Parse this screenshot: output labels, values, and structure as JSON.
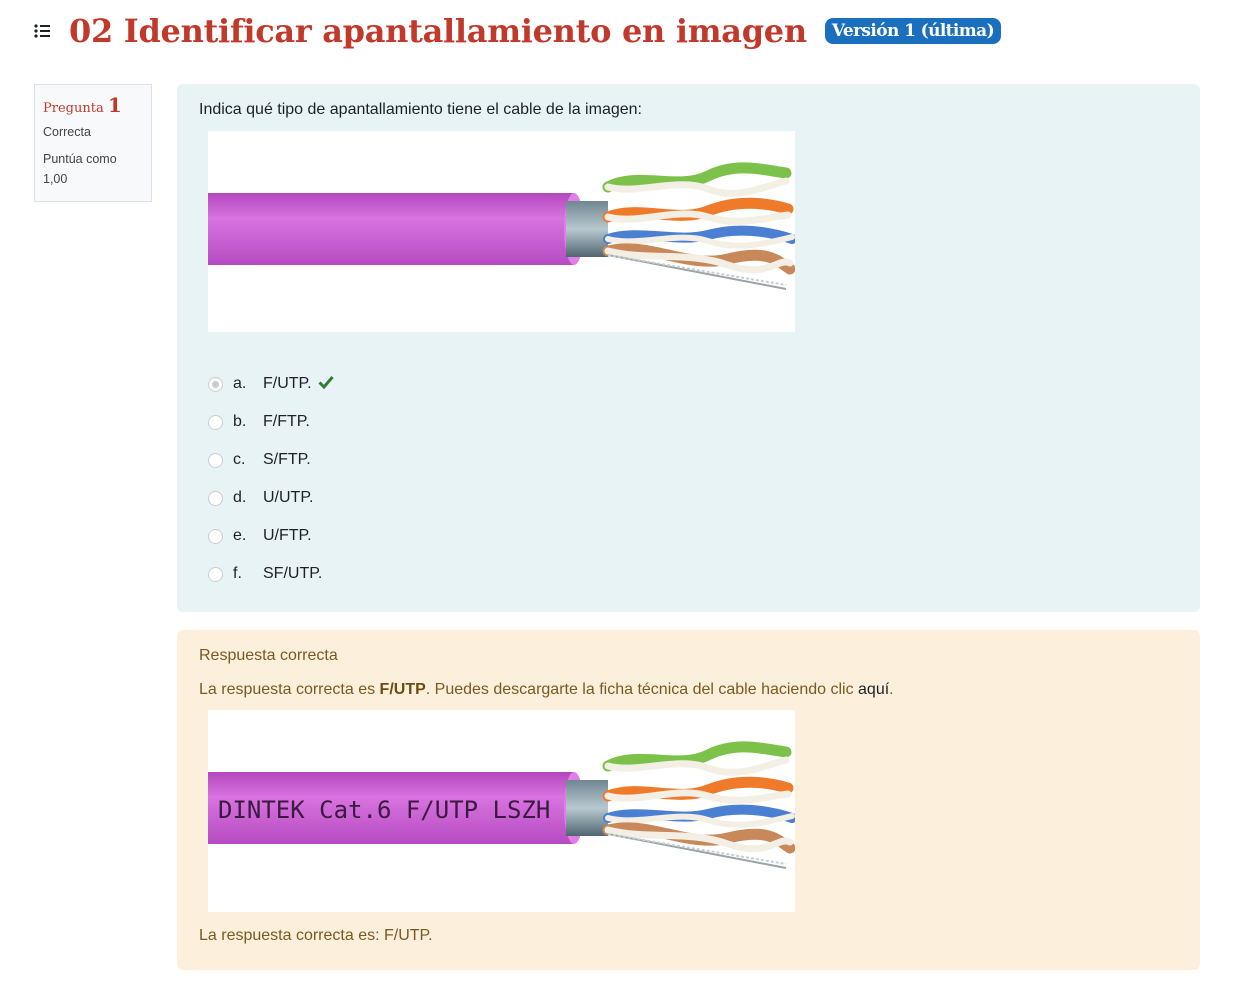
{
  "header": {
    "icon": "list-icon",
    "title": "02 Identificar apantallamiento en imagen",
    "version_badge": "Versión 1 (última)"
  },
  "info": {
    "question_label": "Pregunta",
    "question_number": "1",
    "state": "Correcta",
    "grade": "Puntúa como 1,00"
  },
  "question": {
    "text": "Indica qué tipo de apantallamiento tiene el cable de la imagen:",
    "answers": [
      {
        "letter": "a.",
        "text": "F/UTP.",
        "selected": true,
        "correct": true
      },
      {
        "letter": "b.",
        "text": "F/FTP.",
        "selected": false
      },
      {
        "letter": "c.",
        "text": "S/FTP.",
        "selected": false
      },
      {
        "letter": "d.",
        "text": "U/UTP.",
        "selected": false
      },
      {
        "letter": "e.",
        "text": "U/FTP.",
        "selected": false
      },
      {
        "letter": "f.",
        "text": "SF/UTP.",
        "selected": false
      }
    ]
  },
  "feedback": {
    "title": "Respuesta correcta",
    "line_prefix": "La respuesta correcta es ",
    "line_bold": "F/UTP",
    "line_middle": ". Puedes descargarte la ficha técnica del cable haciendo clic ",
    "line_link": "aquí",
    "line_suffix": ".",
    "cable_print": "DINTEK Cat.6 F/UTP LSZH",
    "right_answer": "La respuesta correcta es: F/UTP."
  },
  "colors": {
    "title": "#c0392b",
    "badge": "#1b6fbf",
    "formulation_bg": "#e7f3f5",
    "feedback_bg": "#fcefdc",
    "correct_tick": "#2e7d32",
    "cable_jacket": "#cc5fd6"
  }
}
